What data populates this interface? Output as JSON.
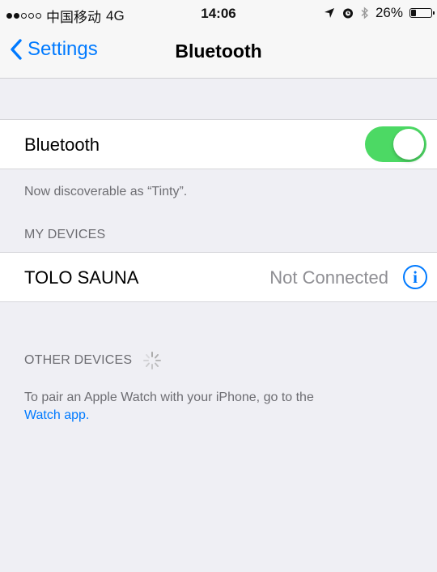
{
  "status_bar": {
    "carrier": "中国移动",
    "network": "4G",
    "time": "14:06",
    "battery_percent": "26%",
    "battery_level": 0.26
  },
  "nav": {
    "back_label": "Settings",
    "title": "Bluetooth"
  },
  "bluetooth": {
    "label": "Bluetooth",
    "enabled": true,
    "discoverable_text": "Now discoverable as “Tinty”."
  },
  "my_devices": {
    "header": "MY DEVICES",
    "items": [
      {
        "name": "TOLO SAUNA",
        "status": "Not Connected",
        "info_glyph": "i"
      }
    ]
  },
  "other_devices": {
    "header": "OTHER DEVICES",
    "footer_text": "To pair an Apple Watch with your iPhone, go to the",
    "footer_link": "Watch app."
  },
  "colors": {
    "accent": "#007aff",
    "toggle_on": "#4cd964",
    "background": "#efeff4",
    "secondary_text": "#6d6d72"
  },
  "icons": [
    "signal-dots-icon",
    "location-arrow-icon",
    "alarm-icon",
    "bluetooth-icon",
    "battery-icon",
    "chevron-left-icon",
    "info-icon",
    "spinner-icon"
  ]
}
